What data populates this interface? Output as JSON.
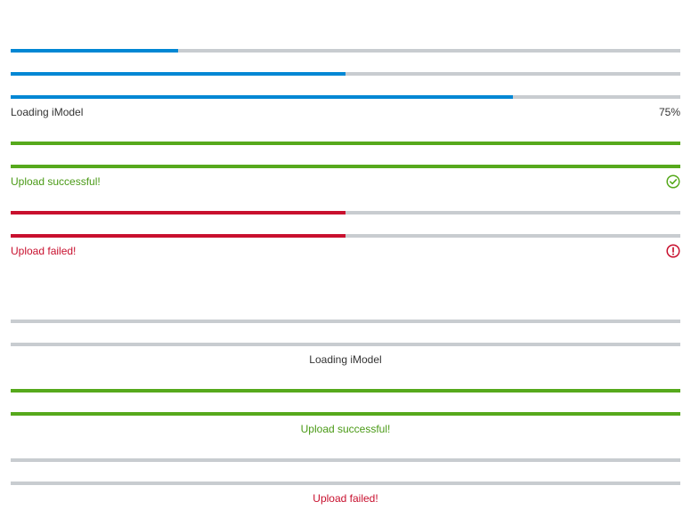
{
  "colors": {
    "track": "#c8ccd0",
    "informational": "#0087d4",
    "positive": "#56a91c",
    "negative": "#c8102e",
    "text": "#333333"
  },
  "linear_left": {
    "bars": [
      {
        "status": "informational",
        "progress": 25
      },
      {
        "status": "informational",
        "progress": 50
      },
      {
        "status": "informational",
        "progress": 75
      }
    ],
    "loading_label": "Loading iModel",
    "loading_value": "75%",
    "success_bars": [
      {
        "status": "positive",
        "progress": 100
      },
      {
        "status": "positive",
        "progress": 100
      }
    ],
    "success_label": "Upload successful!",
    "success_icon": "checkmark-circle-icon",
    "failed_bars": [
      {
        "status": "negative",
        "progress": 50
      },
      {
        "status": "negative",
        "progress": 50
      }
    ],
    "failed_label": "Upload failed!",
    "failed_icon": "status-error-icon"
  },
  "linear_centered": {
    "indeterminate_bars": [
      {
        "status": "indeterminate",
        "progress": 0
      },
      {
        "status": "indeterminate",
        "progress": 0
      }
    ],
    "loading_label": "Loading iModel",
    "success_bars": [
      {
        "status": "positive",
        "progress": 100
      },
      {
        "status": "positive",
        "progress": 100
      }
    ],
    "success_label": "Upload successful!",
    "failed_bars": [
      {
        "status": "negative",
        "progress": 0
      },
      {
        "status": "negative",
        "progress": 0
      }
    ],
    "failed_label": "Upload failed!"
  }
}
